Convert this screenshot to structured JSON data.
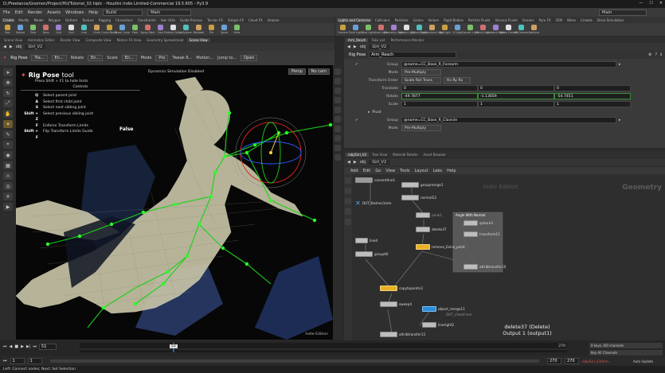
{
  "titlebar": {
    "title": "D:/Freelance/Gnomon/Project/HU/Tutorial_02.hiplc - Houdini Indie Limited-Commercial 19.5.605 - Py3.9"
  },
  "menubar": {
    "items": [
      "File",
      "Edit",
      "Render",
      "Assets",
      "Windows",
      "Help"
    ],
    "build_label": "Build",
    "main_label": "Main",
    "right_label": "Main"
  },
  "shelf_left": {
    "tabs": [
      "Create",
      "Modify",
      "Model",
      "Polygon",
      "Deform",
      "Texture",
      "Rigging",
      "Characters",
      "Constraints",
      "Hair Utils",
      "Guide Process",
      "Terrain FX",
      "Simple FX",
      "Cloud FX",
      "Volume"
    ],
    "tools": [
      "Box",
      "Sphere",
      "Tube",
      "Torus",
      "Grid",
      "Null",
      "Line",
      "Circle",
      "Curve Bezier",
      "Draw Curve",
      "Path",
      "Spray Paint",
      "Font",
      "Platonic Solids",
      "L-System",
      "Metaball",
      "File",
      "Spiral",
      "Helix"
    ]
  },
  "shelf_right": {
    "tabs": [
      "Lights and Cameras",
      "Collisions",
      "Particles",
      "Grains",
      "Vellum",
      "Rigid Bodies",
      "Particle Fluids",
      "Viscous Fluids",
      "Oceans",
      "Pyro FX",
      "FEM",
      "Wires",
      "Crowds",
      "Drive Simulation"
    ],
    "tools": [
      "Camera",
      "Point Light",
      "Spot Light",
      "Area Light",
      "Geometry Light",
      "Volume Light",
      "Distant Light",
      "Environment Light",
      "Sky Light",
      "GI Light",
      "Caustic Light",
      "Portal Light",
      "Ambient Light",
      "Stereo Camera",
      "VR Camera",
      "Switcher"
    ]
  },
  "left_pane": {
    "tabs": [
      "Scene View",
      "Animation Editor",
      "Render View",
      "Composite View",
      "Motion FX View",
      "Geometry Spreadsheet",
      "Scene View"
    ],
    "path": [
      "obj",
      "Girl_V2"
    ],
    "tool_options": {
      "tool_name": "Rig Pose",
      "translate": "Translate",
      "rotate": "Rotate",
      "scale": "Scale",
      "mode": "Mode",
      "tweak": "Tweak R...",
      "motion": "Motion...",
      "jump": "Jump to...",
      "open": "Open"
    }
  },
  "viewport": {
    "dyn_text": "Dynamics Simulation Disabled",
    "persp": "Persp",
    "cam": "No cam",
    "tool_title": "Rig Pose",
    "tool_title_suffix": "tool",
    "hint": "Press Shift + F1 to hide hints",
    "controls_heading": "Controls",
    "hotkeys": [
      {
        "key": "Q",
        "desc": "Select parent joint"
      },
      {
        "key": "A",
        "desc": "Select first child joint"
      },
      {
        "key": "S",
        "desc": "Select next sibling joint"
      },
      {
        "key": "Shift + Z",
        "desc": "Select previous sibling joint"
      },
      {
        "key": "F",
        "desc": "Enforce Transform Limits"
      },
      {
        "key": "Shift + F",
        "desc": "Flip Transform Limits Guide"
      }
    ],
    "enforce_value": "False",
    "watermark": "Indie Edition"
  },
  "params_pane": {
    "tabs": [
      "Arm_Reach",
      "Take List",
      "Performance Monitor"
    ],
    "path": [
      "obj",
      "Girl_V2"
    ],
    "node_type": "Rig Pose",
    "node_name": "Arm_Reach",
    "rows": {
      "group1_label": "Group",
      "group1_value": "@name=CC_Base_R_Forearm",
      "mode1_label": "Mode",
      "mode1_value": "Pre-Multiply",
      "xform_label": "Transform Order",
      "xform_value": "Scale Rot Trans",
      "rot_order_value": "Rx Ry Rz",
      "translate_label": "Translate",
      "translate": [
        "0",
        "0",
        "0"
      ],
      "rotate_label": "Rotate",
      "rotate": [
        "-49.7877",
        "-1.13659",
        "-54.7451"
      ],
      "scale_label": "Scale",
      "scale": [
        "1",
        "1",
        "1"
      ],
      "pivot_label": "Pivot",
      "group2_label": "Group",
      "group2_value": "@name=CC_Base_R_Clavicle",
      "mode2_label": "Mode",
      "mode2_value": "Pre-Multiply"
    }
  },
  "network_pane": {
    "tabs": [
      "/obj/Girl_V2",
      "Tree View",
      "Material Palette",
      "Asset Browser"
    ],
    "path": [
      "obj",
      "Girl_V2"
    ],
    "menu": [
      "Add",
      "Edit",
      "Go",
      "View",
      "Tools",
      "Layout",
      "Labs",
      "Help"
    ],
    "indie": "Indie Edition",
    "context": "Geometry",
    "nodes": [
      "convertline1",
      "groupmerge1",
      "normal12",
      "OUT_tleshes1mm",
      "peak1",
      "delete37",
      "remove_Extra_point",
      "line4",
      "group46",
      "copytopoints3",
      "sweep4",
      "object_merge11",
      "OUT_chesV.mm",
      "lineright2",
      "attribtransfer11",
      "sphere3",
      "transform11",
      "attribtransfer10"
    ],
    "netbox_title": "Angle With Normal",
    "selected_info": {
      "line1": "delete37 (Delete)",
      "line2": "Output 1 (output1)"
    }
  },
  "timeline": {
    "frame": "51",
    "start": "1",
    "start2": "1",
    "end": "270",
    "end2": "270",
    "keys_label": "0 keys, 0/0 channels",
    "all_channels": "Key All Channels",
    "auto_update": "Auto Update",
    "path_label": "/obj/Girl_V2/Arm..."
  },
  "statusbar": {
    "text": "Left: Connect nodes; Next: Set Selection"
  }
}
